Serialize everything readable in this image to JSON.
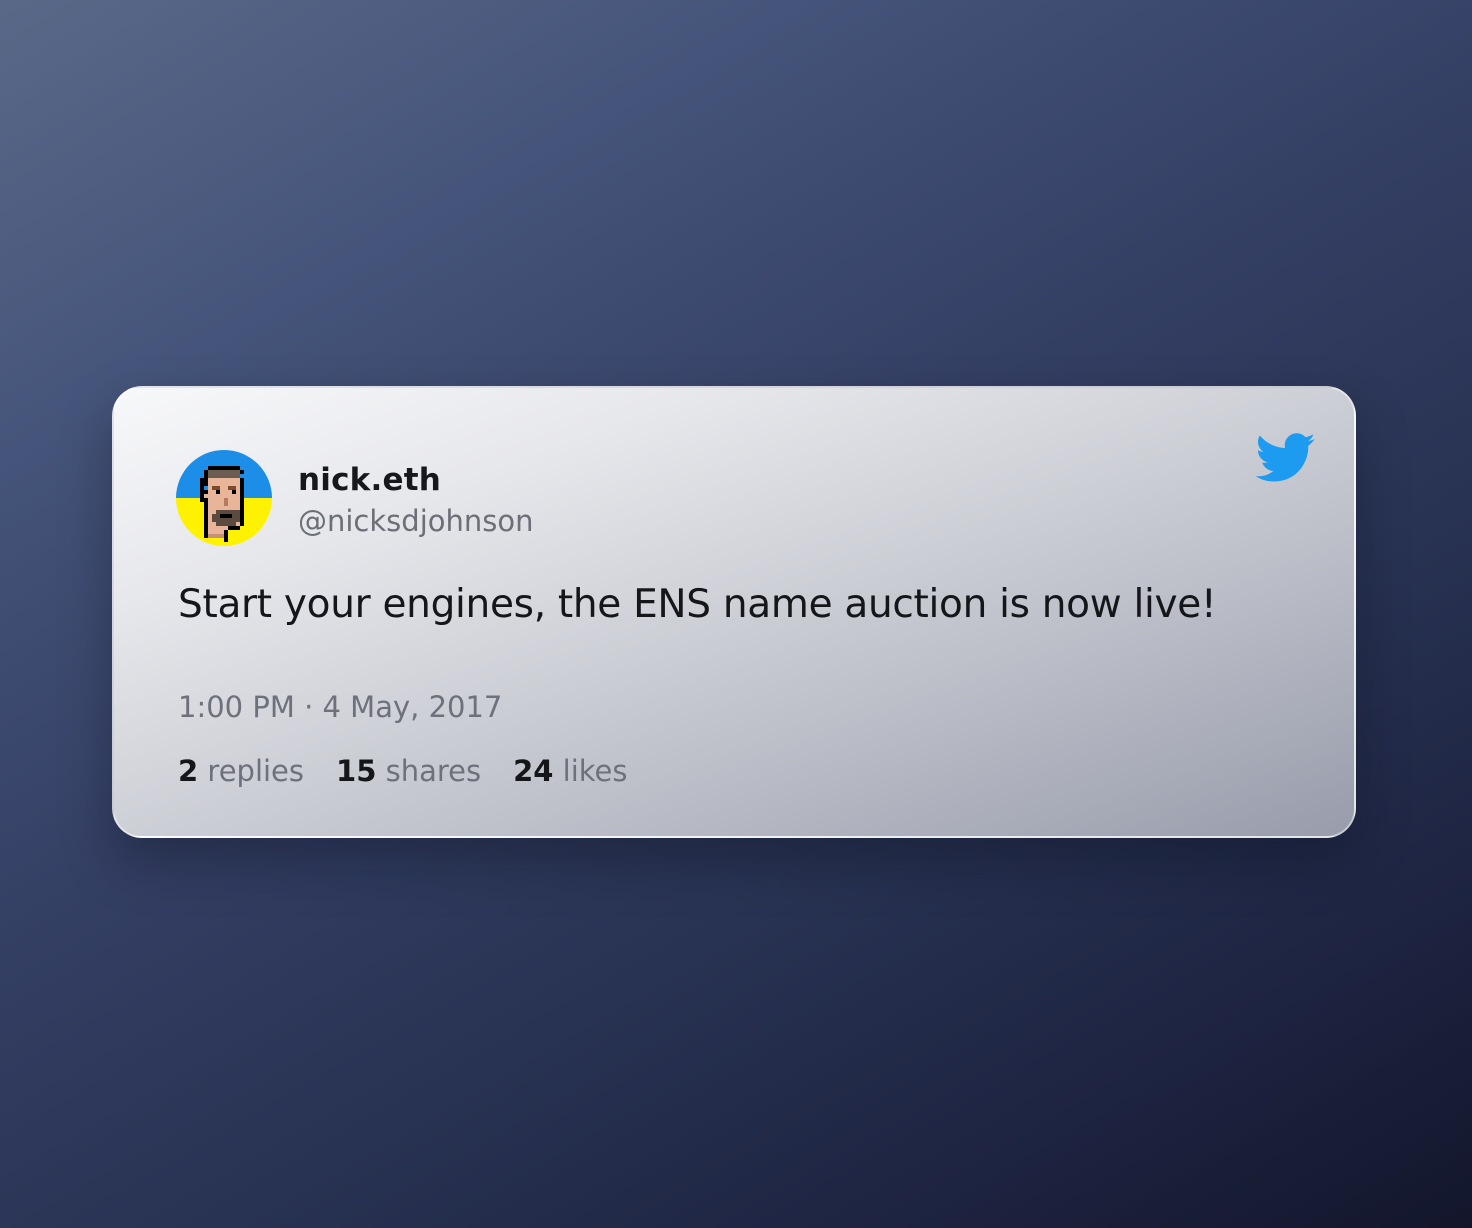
{
  "tweet": {
    "author": {
      "display_name": "nick.eth",
      "handle": "@nicksdjohnson",
      "avatar": "pixel-art-punk-avatar-blue-yellow-background"
    },
    "text": "Start your engines, the ENS name auction is now live!",
    "timestamp": "1:00 PM · 4 May, 2017",
    "stats": {
      "replies_count": "2",
      "replies_label": "replies",
      "shares_count": "15",
      "shares_label": "shares",
      "likes_count": "24",
      "likes_label": "likes"
    },
    "platform_icon": "twitter-bird-icon"
  },
  "colors": {
    "twitter_blue": "#1d9bf0",
    "avatar_blue": "#1c8ee8",
    "avatar_yellow": "#fff200"
  }
}
